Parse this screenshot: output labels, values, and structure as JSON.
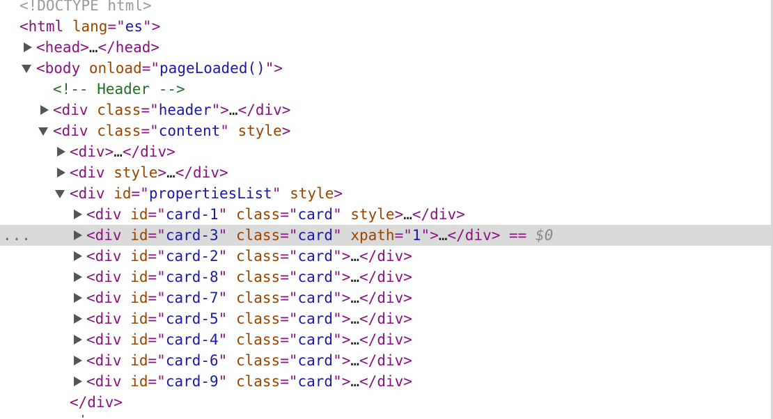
{
  "dom": {
    "doctype": "<!DOCTYPE html>",
    "html_open": {
      "tag": "html",
      "attr": "lang",
      "value": "es"
    },
    "head": {
      "tag": "head",
      "collapsed": true
    },
    "body": {
      "tag": "body",
      "attr": "onload",
      "value": "pageLoaded()"
    },
    "comment": "<!-- Header -->",
    "header_div": {
      "tag": "div",
      "attr": "class",
      "value": "header"
    },
    "content_div": {
      "tag": "div",
      "attr1": "class",
      "value1": "content",
      "attr2": "style"
    },
    "inner_div_1": {
      "tag": "div"
    },
    "inner_div_2": {
      "tag": "div",
      "attr": "style"
    },
    "properties_list": {
      "tag": "div",
      "attr1": "id",
      "value1": "propertiesList",
      "attr2": "style"
    },
    "cards": [
      {
        "id": "card-1",
        "class": "card",
        "extra_attr": "style",
        "extra_value": ""
      },
      {
        "id": "card-3",
        "class": "card",
        "extra_attr": "xpath",
        "extra_value": "1",
        "selected": true
      },
      {
        "id": "card-2",
        "class": "card"
      },
      {
        "id": "card-8",
        "class": "card"
      },
      {
        "id": "card-7",
        "class": "card"
      },
      {
        "id": "card-5",
        "class": "card"
      },
      {
        "id": "card-4",
        "class": "card"
      },
      {
        "id": "card-6",
        "class": "card"
      },
      {
        "id": "card-9",
        "class": "card"
      }
    ],
    "closing_div": "</div>",
    "selected_marker": "== $0",
    "row_dots": "...",
    "ellipsis": "…"
  }
}
